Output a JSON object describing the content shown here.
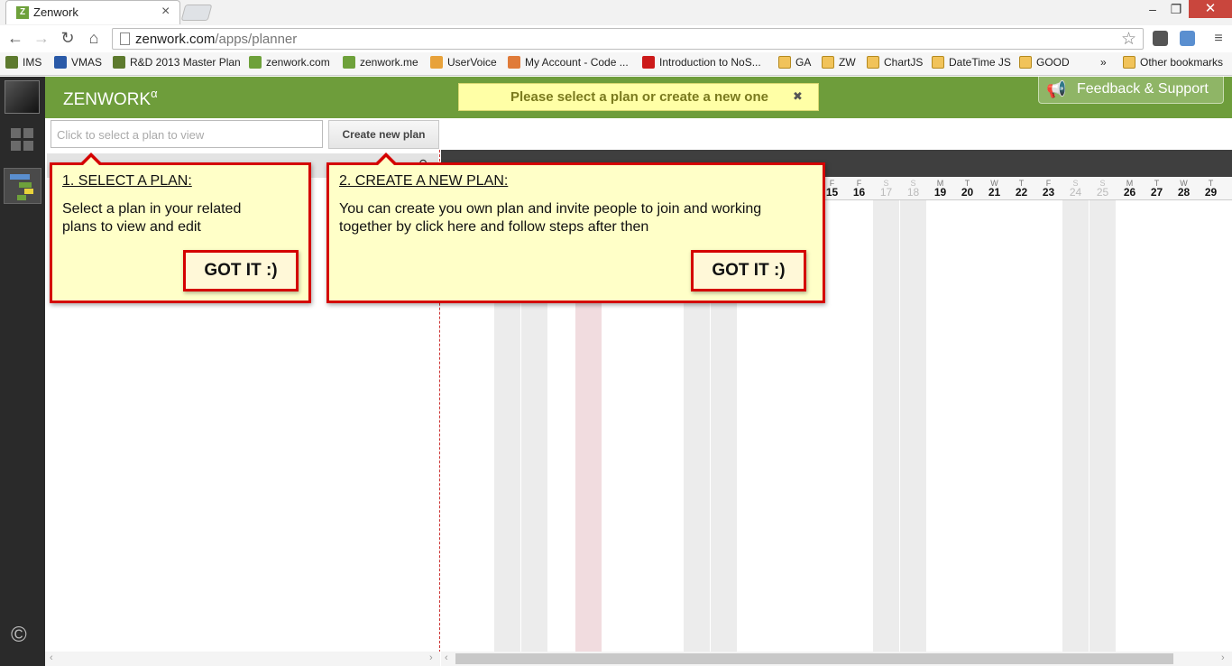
{
  "browser": {
    "tab_title": "Zenwork",
    "tab_favicon": "Z",
    "url_host": "zenwork.com",
    "url_path": "/apps/planner",
    "bookmarks": [
      {
        "label": "IMS",
        "icon": "ims-icon"
      },
      {
        "label": "VMAS",
        "icon": "vmas-icon"
      },
      {
        "label": "R&D 2013 Master Plan",
        "icon": "ims-icon"
      },
      {
        "label": "zenwork.com",
        "icon": "zenwork-icon"
      },
      {
        "label": "zenwork.me",
        "icon": "zenwork-icon"
      },
      {
        "label": "UserVoice",
        "icon": "uservoice-icon"
      },
      {
        "label": "My Account - Code ...",
        "icon": "code-icon"
      },
      {
        "label": "Introduction to NoS...",
        "icon": "youtube-icon"
      },
      {
        "label": "GA",
        "icon": "folder-icon"
      },
      {
        "label": "ZW",
        "icon": "folder-icon"
      },
      {
        "label": "ChartJS",
        "icon": "folder-icon"
      },
      {
        "label": "DateTime JS",
        "icon": "folder-icon"
      },
      {
        "label": "GOOD",
        "icon": "folder-icon"
      }
    ],
    "overflow": "»",
    "other_bookmarks": "Other bookmarks"
  },
  "app": {
    "brand": "ZENWORK",
    "brand_sup": "α",
    "notice": "Please select a plan or create a new one",
    "notice_close": "✖",
    "feedback": "Feedback & Support",
    "copyright": "©",
    "select_placeholder": "Click to select a plan to view",
    "create_button": "Create new plan",
    "accent_color": "#6e9d3b"
  },
  "calendar": {
    "days": [
      {
        "dow": "F",
        "num": "15",
        "weekend": false
      },
      {
        "dow": "F",
        "num": "16",
        "weekend": false
      },
      {
        "dow": "S",
        "num": "17",
        "weekend": true
      },
      {
        "dow": "S",
        "num": "18",
        "weekend": true
      },
      {
        "dow": "M",
        "num": "19",
        "weekend": false
      },
      {
        "dow": "T",
        "num": "20",
        "weekend": false
      },
      {
        "dow": "W",
        "num": "21",
        "weekend": false
      },
      {
        "dow": "T",
        "num": "22",
        "weekend": false
      },
      {
        "dow": "F",
        "num": "23",
        "weekend": false
      },
      {
        "dow": "S",
        "num": "24",
        "weekend": true
      },
      {
        "dow": "S",
        "num": "25",
        "weekend": true
      },
      {
        "dow": "M",
        "num": "26",
        "weekend": false
      },
      {
        "dow": "T",
        "num": "27",
        "weekend": false
      },
      {
        "dow": "W",
        "num": "28",
        "weekend": false
      },
      {
        "dow": "T",
        "num": "29",
        "weekend": false
      }
    ]
  },
  "tips": {
    "select": {
      "title": "1. SELECT A PLAN:",
      "line1": "Select a plan in your related",
      "line2": "plans to view and edit",
      "button": "GOT IT :)"
    },
    "create": {
      "title": "2. CREATE A NEW PLAN:",
      "line1": "You can create you own plan and invite people to join and working",
      "line2": "together by click here and follow steps after then",
      "button": "GOT IT :)"
    }
  }
}
